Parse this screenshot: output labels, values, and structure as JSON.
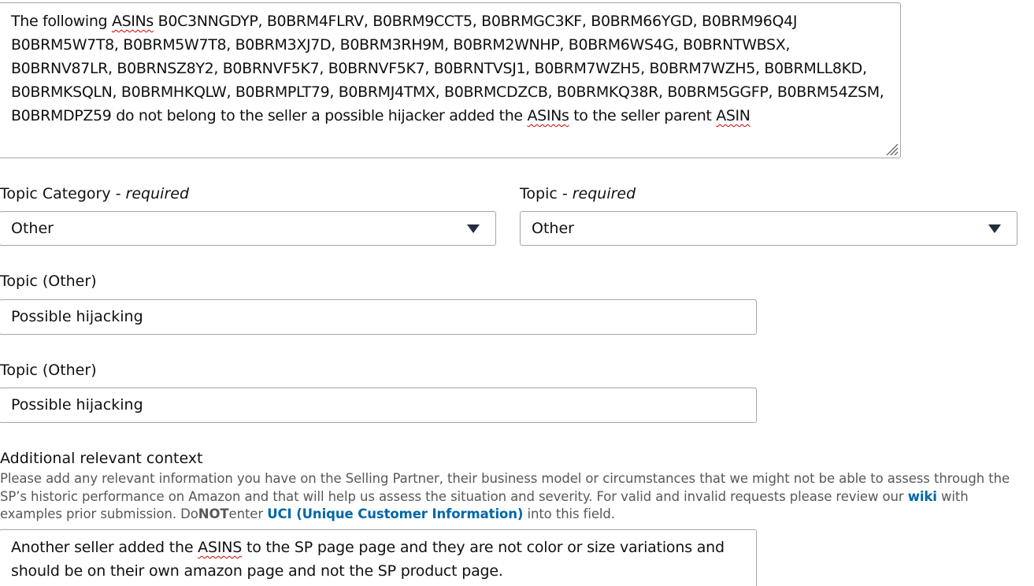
{
  "description_textarea": {
    "part1": "The following ",
    "asins_word": "ASINs",
    "part2": " B0C3NNGDYP, B0BRM4FLRV, B0BRM9CCT5, B0BRMGC3KF, B0BRM66YGD, B0BRM96Q4J B0BRM5W7T8, B0BRM5W7T8, B0BRM3XJ7D, B0BRM3RH9M, B0BRM2WNHP, B0BRM6WS4G, B0BRNTWBSX, B0BRNV87LR, B0BRNSZ8Y2, B0BRNVF5K7, B0BRNVF5K7, B0BRNTVSJ1, B0BRM7WZH5, B0BRM7WZH5, B0BRMLL8KD, B0BRMKSQLN, B0BRMHKQLW, B0BRMPLT79, B0BRMJ4TMX, B0BRMCDZCB, B0BRMKQ38R, B0BRM5GGFP, B0BRM54ZSM, B0BRMDPZ59 do not belong to the seller a possible hijacker added the ",
    "asins_word2": "ASINs",
    "part3": " to the seller parent ",
    "asin_word": "ASIN"
  },
  "topic_category": {
    "label": "Topic Category",
    "required_text": " - required",
    "value": "Other"
  },
  "topic": {
    "label": "Topic",
    "required_text": " - required",
    "value": "Other"
  },
  "topic_other_1": {
    "label": "Topic (Other)",
    "value": "Possible hijacking"
  },
  "topic_other_2": {
    "label": "Topic (Other)",
    "value": "Possible hijacking"
  },
  "additional_context": {
    "label": "Additional relevant context",
    "help_part1": "Please add any relevant information you have on the Selling Partner, their business model or circumstances that we might not be able to assess through the SP’s historic performance on Amazon and that will help us assess the situation and severity. For valid and invalid requests please review our ",
    "help_link_wiki": "wiki",
    "help_part2": " with examples prior submission. Do",
    "help_not": "NOT",
    "help_part3": "enter ",
    "help_link_uci": "UCI (Unique Customer Information)",
    "help_part4": " into this field.",
    "value_part1": "Another seller added the ",
    "value_asins": "ASINS",
    "value_part2": " to the SP page page and they are not color or size variations and should be on their own amazon page and not the SP product page."
  }
}
